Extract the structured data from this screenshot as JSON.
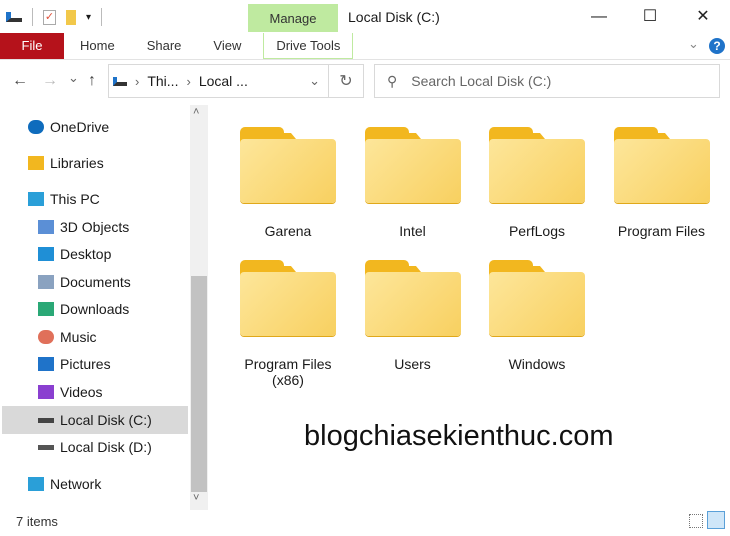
{
  "window": {
    "title": "Local Disk (C:)",
    "context_tab": "Manage",
    "minimize": "—",
    "maximize": "☐",
    "close": "✕"
  },
  "ribbon": {
    "tabs": [
      "File",
      "Home",
      "Share",
      "View",
      "Drive Tools"
    ]
  },
  "nav": {
    "back": "←",
    "forward": "→",
    "recent": "⌄",
    "up": "↑",
    "breadcrumb": [
      "Thi...",
      "Local ..."
    ],
    "refresh": "↻"
  },
  "search": {
    "placeholder": "Search Local Disk (C:)"
  },
  "sidebar": {
    "items": [
      {
        "label": "OneDrive",
        "icon": "cloud-icon",
        "color": "#0f6cbd"
      },
      {
        "label": "Libraries",
        "icon": "libraries-icon",
        "color": "#f2b71f"
      },
      {
        "label": "This PC",
        "icon": "computer-icon",
        "color": "#2a9fd8"
      },
      {
        "label": "3D Objects",
        "icon": "cube-icon",
        "color": "#5b8fd6"
      },
      {
        "label": "Desktop",
        "icon": "desktop-icon",
        "color": "#1f8fd6"
      },
      {
        "label": "Documents",
        "icon": "document-icon",
        "color": "#8aa2c0"
      },
      {
        "label": "Downloads",
        "icon": "download-icon",
        "color": "#2aa876"
      },
      {
        "label": "Music",
        "icon": "music-icon",
        "color": "#e0705a"
      },
      {
        "label": "Pictures",
        "icon": "pictures-icon",
        "color": "#1f73c9"
      },
      {
        "label": "Videos",
        "icon": "videos-icon",
        "color": "#8a3fd0"
      },
      {
        "label": "Local Disk (C:)",
        "icon": "drive-icon",
        "color": "#444444",
        "selected": true
      },
      {
        "label": "Local Disk (D:)",
        "icon": "drive-icon",
        "color": "#555555"
      },
      {
        "label": "Network",
        "icon": "network-icon",
        "color": "#2a9fd8"
      }
    ]
  },
  "folders": [
    {
      "name": "Garena"
    },
    {
      "name": "Intel"
    },
    {
      "name": "PerfLogs"
    },
    {
      "name": "Program Files"
    },
    {
      "name": "Program Files (x86)"
    },
    {
      "name": "Users"
    },
    {
      "name": "Windows"
    }
  ],
  "status": {
    "items": "7 items"
  },
  "watermark": "blogchiasekienthuc.com"
}
